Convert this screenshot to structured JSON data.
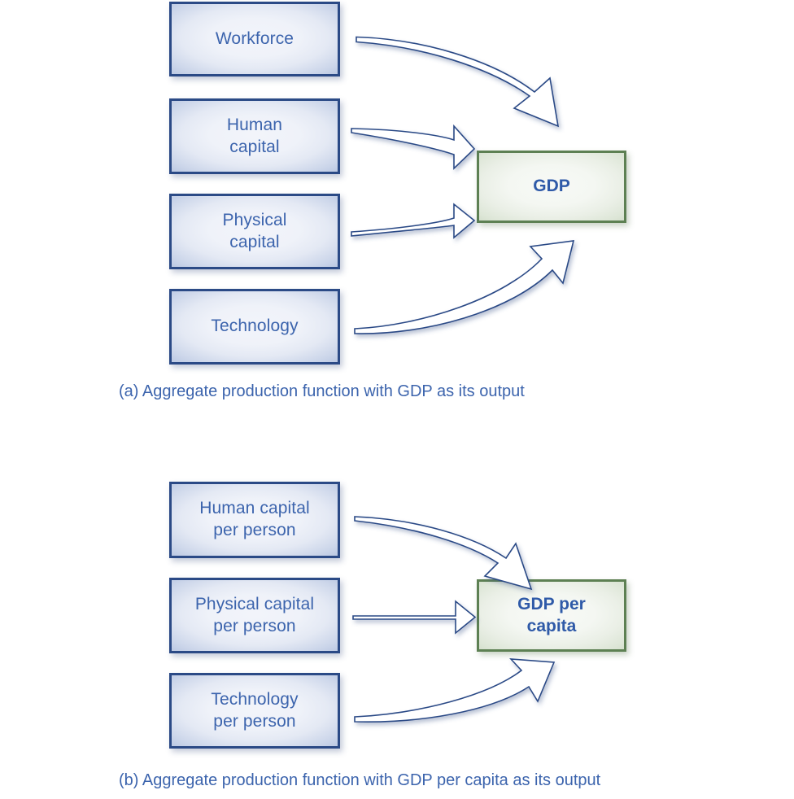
{
  "figure": {
    "panels": [
      {
        "id": "panel-a",
        "caption": "(a) Aggregate production function with GDP as its output",
        "inputs": [
          {
            "id": "workforce",
            "line1": "Workforce",
            "line2": ""
          },
          {
            "id": "human-capital",
            "line1": "Human",
            "line2": "capital"
          },
          {
            "id": "physical-capital",
            "line1": "Physical",
            "line2": "capital"
          },
          {
            "id": "technology",
            "line1": "Technology",
            "line2": ""
          }
        ],
        "output": {
          "id": "gdp",
          "line1": "GDP",
          "line2": ""
        }
      },
      {
        "id": "panel-b",
        "caption": "(b) Aggregate production function with GDP per capita as its output",
        "inputs": [
          {
            "id": "human-capital-per-person",
            "line1": "Human capital",
            "line2": "per person"
          },
          {
            "id": "physical-capital-per-person",
            "line1": "Physical capital",
            "line2": "per person"
          },
          {
            "id": "technology-per-person",
            "line1": "Technology",
            "line2": "per person"
          }
        ],
        "output": {
          "id": "gdp-per-capita",
          "line1": "GDP per",
          "line2": "capita"
        }
      }
    ]
  },
  "colors": {
    "input_box_border": "#2b4a86",
    "output_box_border": "#5d8053",
    "input_text": "#3c64ad",
    "output_text": "#2f5aa8",
    "caption_text": "#3c64ad",
    "arrow_stroke": "#2b4a86",
    "arrow_fill": "#ffffff",
    "background": "#ffffff"
  },
  "icons": {
    "arrow_a_1": "curved-down-arrow-icon",
    "arrow_a_2": "curved-right-arrow-icon",
    "arrow_a_3": "curved-up-arrow-icon",
    "arrow_a_4": "curved-up-arrow-icon",
    "arrow_b_1": "curved-down-arrow-icon",
    "arrow_b_2": "straight-right-arrow-icon",
    "arrow_b_3": "curved-up-arrow-icon"
  }
}
